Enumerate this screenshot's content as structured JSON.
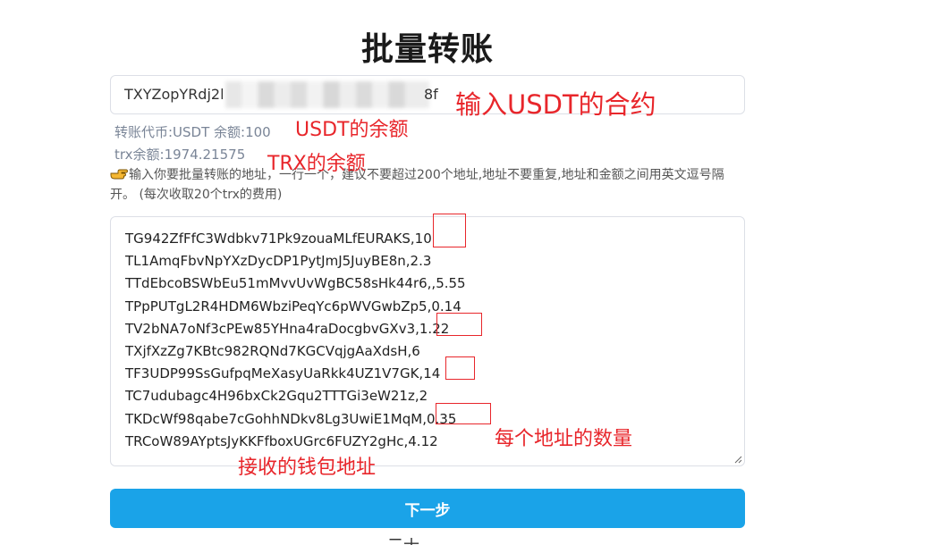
{
  "page": {
    "title": "批量转账",
    "contract_prefix": "TXYZopYRdj2l",
    "contract_suffix": "8f",
    "token_balance": "转账代币:USDT 余额:100",
    "trx_balance": "trx余额:1974.21575",
    "note": "输入你要批量转账的地址，一行一个，建议不要超过200个地址,地址不要重复,地址和金额之间用英文逗号隔开。 (每次收取20个trx的费用)",
    "addresses": [
      "TG942ZfFfC3Wdbkv71Pk9zouaMLfEURAKS,10",
      "TL1AmqFbvNpYXzDycDP1PytJmJ5JuyBE8n,2.3",
      "TTdEbcoBSWbEu51mMvvUvWgBC58sHk44r6,,5.55",
      "TPpPUTgL2R4HDM6WbziPeqYc6pWVGwbZp5,0.14",
      "TV2bNA7oNf3cPEw85YHna4raDocgbvGXv3,1.22",
      "TXjfXzZg7KBtc982RQNd7KGCVqjgAaXdsH,6",
      "TF3UDP99SsGufpqMeXasyUaRkk4UZ1V7GK,14",
      "TC7udubagc4H96bxCk2Gqu2TTTGi3eW21z,2",
      "TKDcWf98qabe7cGohhNDkv8Lg3UwiE1MqM,0.35",
      "TRCoW89AYptsJyKKFfboxUGrc6FUZY2gHc,4.12"
    ],
    "next_label": "下一步",
    "bottom_partial": "二十"
  },
  "annotations": {
    "contract": "输入USDT的合约",
    "usdt_balance": "USDT的余额",
    "trx_balance": "TRX的余额",
    "amount": "每个地址的数量",
    "receiver": "接收的钱包地址"
  },
  "colors": {
    "primary_button": "#1aa3e8",
    "annotation": "#e8262b",
    "muted_text": "#7a8597"
  },
  "icons": {
    "hand": "pointing-hand-icon",
    "resize": "resize-handle-icon"
  }
}
